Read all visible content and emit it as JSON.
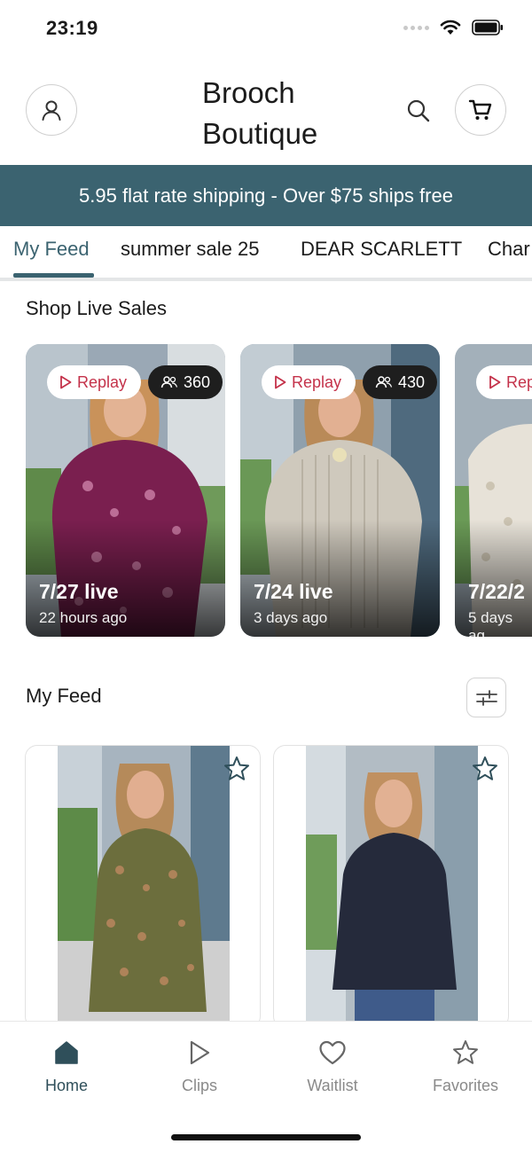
{
  "status_bar": {
    "time": "23:19"
  },
  "header": {
    "store_name": "Brooch Boutique",
    "icons": {
      "profile": "user-icon",
      "search": "search-icon",
      "cart": "cart-icon"
    }
  },
  "banner": {
    "text": "5.95 flat rate shipping - Over $75 ships free",
    "bg_color": "#3b6370"
  },
  "tabs": [
    {
      "label": "My Feed",
      "active": true
    },
    {
      "label": "summer sale 25",
      "active": false
    },
    {
      "label": "DEAR SCARLETT",
      "active": false
    },
    {
      "label": "Char",
      "active": false
    }
  ],
  "live_sales": {
    "title": "Shop Live Sales",
    "cards": [
      {
        "replay_label": "Replay",
        "viewers": "360",
        "date": "7/27 live",
        "ago": "22 hours ago"
      },
      {
        "replay_label": "Replay",
        "viewers": "430",
        "date": "7/24 live",
        "ago": "3 days ago"
      },
      {
        "replay_label": "Rep",
        "viewers": "",
        "date": "7/22/2",
        "ago": "5 days ag"
      }
    ]
  },
  "feed": {
    "title": "My Feed",
    "filter_icon": "sliders-icon",
    "products": [
      {
        "favorite_icon": "star-icon"
      },
      {
        "favorite_icon": "star-icon"
      }
    ]
  },
  "bottom_nav": [
    {
      "label": "Home",
      "icon": "home-icon",
      "active": true
    },
    {
      "label": "Clips",
      "icon": "play-icon",
      "active": false
    },
    {
      "label": "Waitlist",
      "icon": "heart-icon",
      "active": false
    },
    {
      "label": "Favorites",
      "icon": "star-icon",
      "active": false
    }
  ],
  "colors": {
    "accent": "#3b6370",
    "replay": "#c4324a"
  }
}
